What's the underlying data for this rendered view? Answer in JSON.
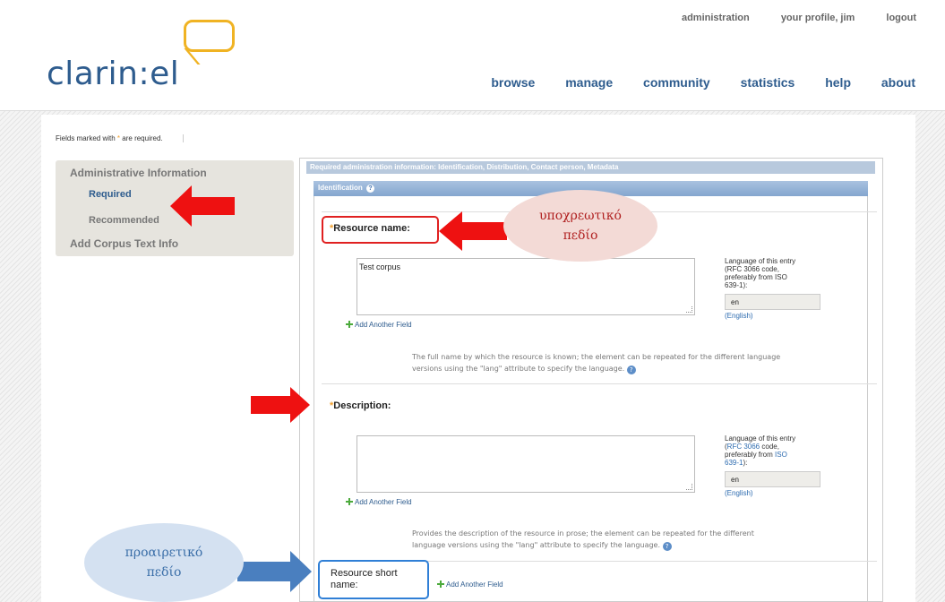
{
  "header": {
    "logo_text": "clarin:el",
    "top_links": [
      "administration",
      "your profile, jim",
      "logout"
    ],
    "nav": [
      "browse",
      "manage",
      "community",
      "statistics",
      "help",
      "about"
    ]
  },
  "form_note": {
    "prefix": "Fields marked with",
    "suffix": "are required.",
    "star": "*"
  },
  "sidebar": {
    "title": "Administrative Information",
    "required": "Required",
    "recommended": "Recommended",
    "add_corpus": "Add Corpus Text Info"
  },
  "section_bar": "Required administration information: Identification, Distribution, Contact person, Metadata",
  "identification_bar": "Identification",
  "help_glyph": "?",
  "resource_name": {
    "label": "Resource name:",
    "value": "Test corpus",
    "lang_note_line1": "Language of this entry",
    "lang_note_line2": "(RFC 3066 code,",
    "lang_note_line3": "preferably from ISO",
    "lang_note_line4": "639-1):",
    "lang_value": "en",
    "lang_name": "(English)",
    "add_field": "Add Another Field",
    "help_line1": "The full name by which the resource is known; the element can be repeated for the different language",
    "help_line2": "versions using the \"lang\" attribute to specify the language."
  },
  "description": {
    "label": "Description:",
    "value": "",
    "lang_note_line1": "Language of this entry",
    "lang_note_line2_pre": "(",
    "lang_note_link1": "RFC 3066",
    "lang_note_line2_post": " code,",
    "lang_note_line3_pre": "preferably from ",
    "lang_note_link2": "ISO",
    "lang_note_link3": "639-1",
    "lang_note_line4_post": "):",
    "lang_value": "en",
    "lang_name": "(English)",
    "add_field": "Add Another Field",
    "help_line1": "Provides the description of the resource in prose; the element can be repeated for the different",
    "help_line2": "language versions using the \"lang\" attribute to specify the language."
  },
  "short_name": {
    "label_line1": "Resource short",
    "label_line2": "name:",
    "add_field": "Add Another Field"
  },
  "annotations": {
    "required_line1": "υποχρεωτικό",
    "required_line2": "πεδίο",
    "optional_line1": "προαιρετικό",
    "optional_line2": "πεδίο"
  },
  "colors": {
    "accent_blue": "#2e5c8e",
    "logo_yellow": "#f0b323",
    "annotation_red": "#e02020",
    "annotation_blue": "#4a7fbf"
  }
}
